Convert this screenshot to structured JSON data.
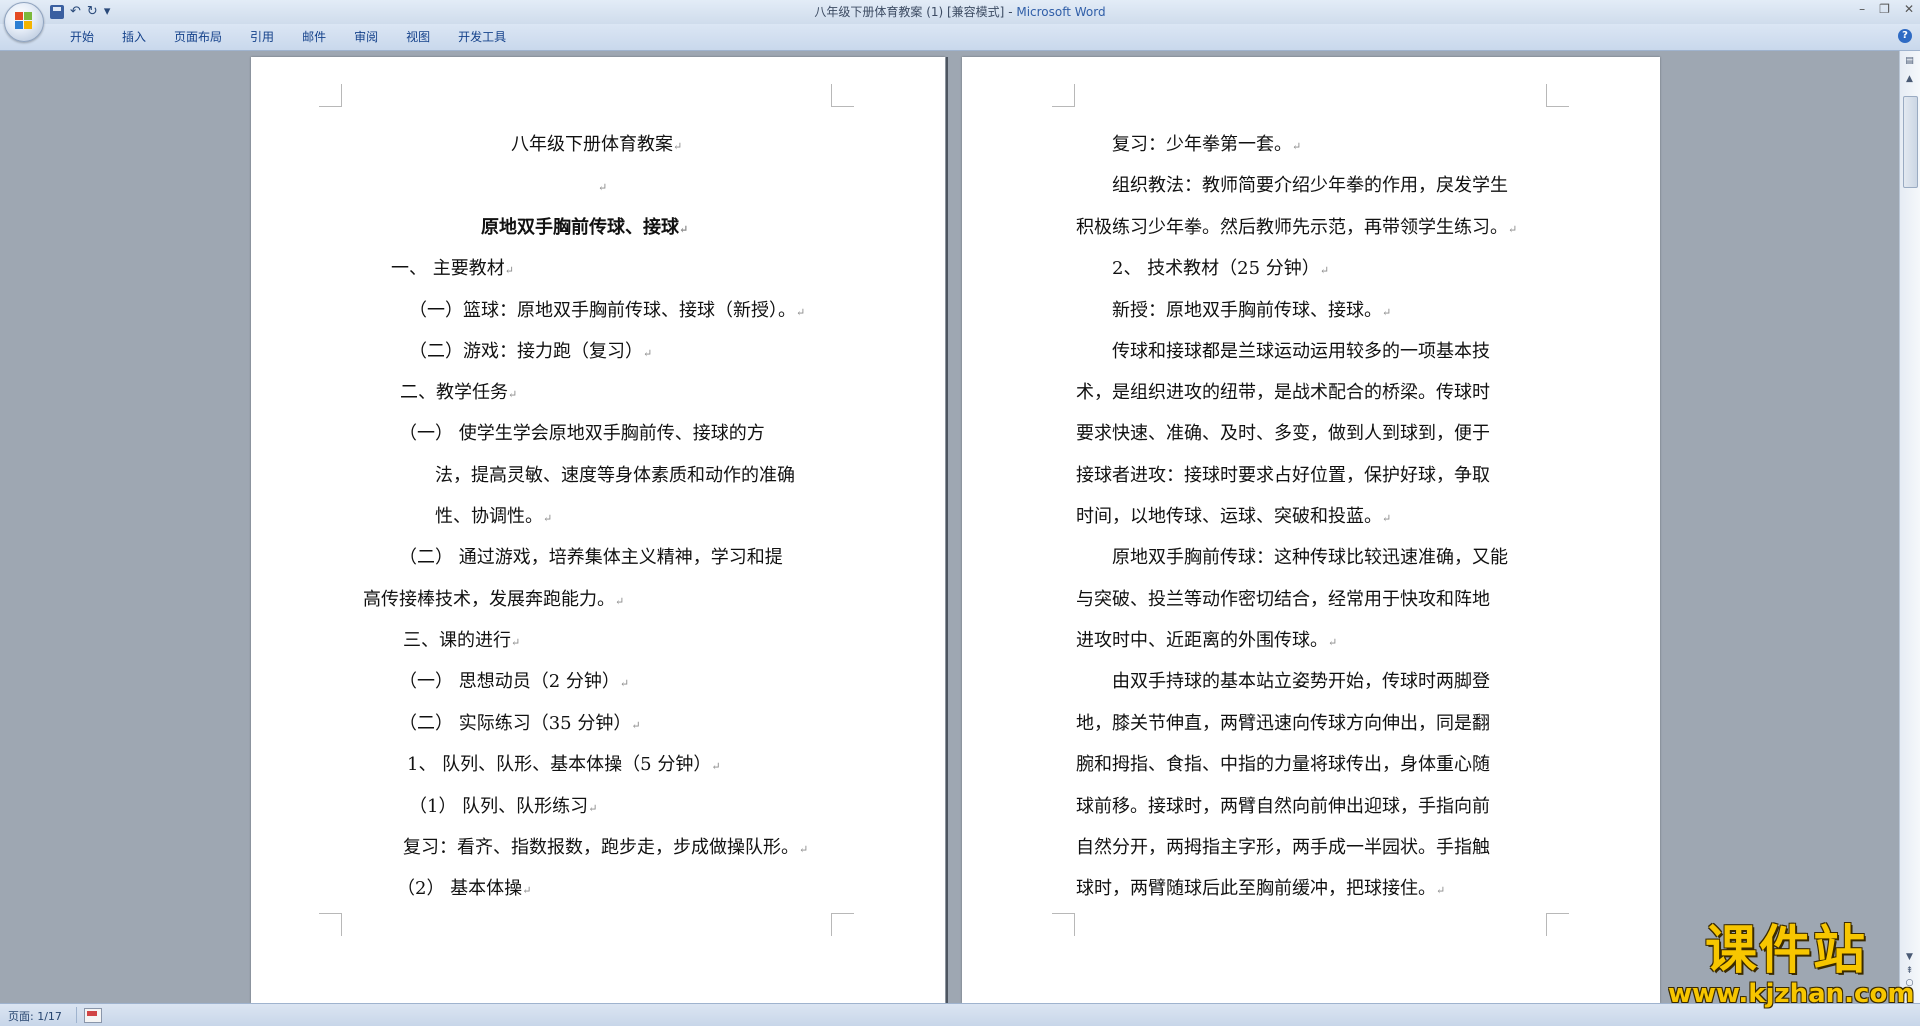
{
  "window": {
    "title": "八年级下册体育教案 (1) [兼容模式]",
    "separator": " - ",
    "app_name": "Microsoft Word",
    "qat_more": "▾",
    "controls": [
      "–",
      "❐",
      "✕"
    ]
  },
  "ribbon": {
    "tabs": [
      {
        "label": "开始"
      },
      {
        "label": "插入"
      },
      {
        "label": "页面布局"
      },
      {
        "label": "引用"
      },
      {
        "label": "邮件"
      },
      {
        "label": "审阅"
      },
      {
        "label": "视图"
      },
      {
        "label": "开发工具"
      }
    ],
    "help": "?"
  },
  "document": {
    "paragraph_mark": "↵",
    "left_page": [
      {
        "text": "八年级下册体育教案",
        "bold": false
      },
      {
        "text": "",
        "bold": false
      },
      {
        "text": "原地双手胸前传球、接球",
        "bold": true
      },
      {
        "text": "一、   主要教材",
        "bold": false
      },
      {
        "text": "（一）篮球：原地双手胸前传球、接球（新授）。",
        "bold": false
      },
      {
        "text": "（二）游戏：接力跑（复习）",
        "bold": false
      },
      {
        "text": "二、教学任务",
        "bold": false
      },
      {
        "text": "（一）    使学生学会原地双手胸前传、接球的方",
        "bold": false,
        "nomark": true
      },
      {
        "text": "法，提高灵敏、速度等身体素质和动作的准确",
        "bold": false,
        "nomark": true
      },
      {
        "text": "性、协调性。",
        "bold": false
      },
      {
        "text": "（二）    通过游戏，培养集体主义精神，学习和提",
        "bold": false,
        "nomark": true
      },
      {
        "text": "高传接棒技术，发展奔跑能力。",
        "bold": false
      },
      {
        "text": "三、课的进行",
        "bold": false
      },
      {
        "text": "（一）    思想动员（2 分钟）",
        "bold": false
      },
      {
        "text": "（二）    实际练习（35 分钟）",
        "bold": false
      },
      {
        "text": "1、 队列、队形、基本体操（5 分钟）",
        "bold": false
      },
      {
        "text": "（1）    队列、队形练习",
        "bold": false
      },
      {
        "text": "复习：看齐、指数报数，跑步走，步成做操队形。",
        "bold": false
      },
      {
        "text": "（2） 基本体操",
        "bold": false
      }
    ],
    "right_page": [
      {
        "text": "复习：少年拳第一套。"
      },
      {
        "text": "组织教法：教师简要介绍少年拳的作用，戾发学生",
        "nomark": true
      },
      {
        "text": "积极练习少年拳。然后教师先示范，再带领学生练习。"
      },
      {
        "text": "2、  技术教材（25 分钟）"
      },
      {
        "text": "新授：原地双手胸前传球、接球。"
      },
      {
        "text": "传球和接球都是兰球运动运用较多的一项基本技",
        "nomark": true
      },
      {
        "text": "术，是组织进攻的纽带，是战术配合的桥梁。传球时",
        "nomark": true
      },
      {
        "text": "要求快速、准确、及时、多变，做到人到球到，便于",
        "nomark": true
      },
      {
        "text": "接球者进攻：接球时要求占好位置，保护好球，争取",
        "nomark": true
      },
      {
        "text": "时间，以地传球、运球、突破和投蓝。"
      },
      {
        "text": "原地双手胸前传球：这种传球比较迅速准确，又能",
        "nomark": true
      },
      {
        "text": "与突破、投兰等动作密切结合，经常用于快攻和阵地",
        "nomark": true
      },
      {
        "text": "进攻时中、近距离的外围传球。"
      },
      {
        "text": "由双手持球的基本站立姿势开始，传球时两脚登",
        "nomark": true
      },
      {
        "text": "地，膝关节伸直，两臂迅速向传球方向伸出，同是翻",
        "nomark": true
      },
      {
        "text": "腕和拇指、食指、中指的力量将球传出，身体重心随",
        "nomark": true
      },
      {
        "text": "球前移。接球时，两臂自然向前伸出迎球，手指向前",
        "nomark": true
      },
      {
        "text": "自然分开，两拇指主字形，两手成一半园状。手指触",
        "nomark": true
      },
      {
        "text": "球时，两臂随球后此至胸前缓冲，把球接住。"
      }
    ]
  },
  "statusbar": {
    "page_info": "页面: 1/17"
  },
  "watermark": {
    "cn": "课件站",
    "en": "www.kjzhan.com"
  },
  "colors": {
    "accent": "#2f5ea8",
    "watermark": "#f7c600"
  }
}
